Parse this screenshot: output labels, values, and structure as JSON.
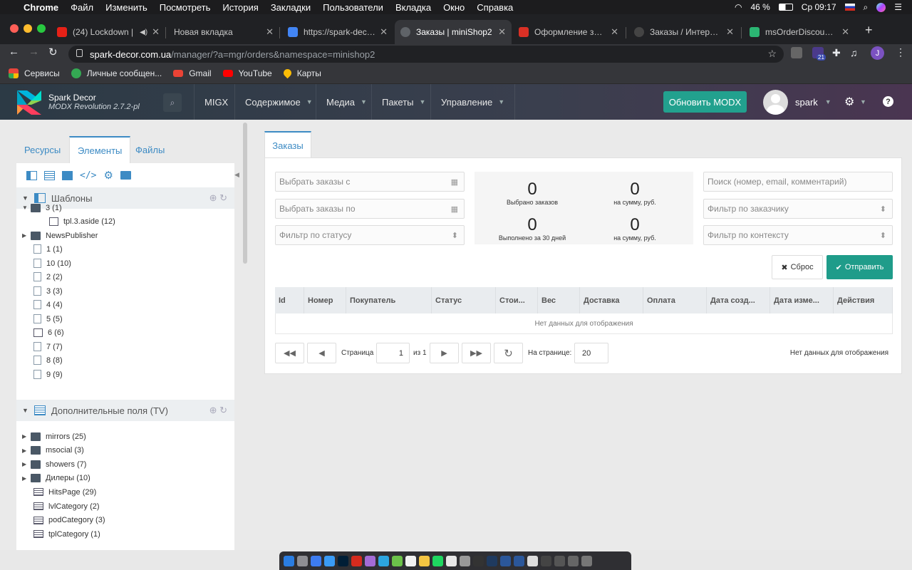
{
  "menubar": {
    "apple": "",
    "app": "Chrome",
    "items": [
      "Файл",
      "Изменить",
      "Посмотреть",
      "История",
      "Закладки",
      "Пользователи",
      "Вкладка",
      "Окно",
      "Справка"
    ],
    "battery": "46 %",
    "clock": "Ср 09:17"
  },
  "tabs": [
    {
      "title": "(24) Lockdown |",
      "color": "#e62117"
    },
    {
      "title": "Новая вкладка",
      "color": ""
    },
    {
      "title": "https://spark-decor.c",
      "color": "#4285f4"
    },
    {
      "title": "Заказы | miniShop2",
      "color": "#5f6368"
    },
    {
      "title": "Оформление заказа",
      "color": "#d93025"
    },
    {
      "title": "Заказы / Интерфейс",
      "color": "#444"
    },
    {
      "title": "msOrderDiscount / K",
      "color": "#2bb673"
    }
  ],
  "address": {
    "host": "spark-decor.com.ua",
    "path": "/manager/?a=mgr/orders&namespace=minishop2",
    "ext_badge": "21",
    "profile": "J"
  },
  "bookmarks": [
    {
      "label": "Сервисы",
      "color": "#e8453c"
    },
    {
      "label": "Личные сообщен...",
      "color": "#34a853"
    },
    {
      "label": "Gmail",
      "color": "#ea4335"
    },
    {
      "label": "YouTube",
      "color": "#ff0000"
    },
    {
      "label": "Карты",
      "color": "#fbbc05"
    }
  ],
  "modx": {
    "site": "Spark Decor",
    "version": "MODX Revolution 2.7.2-pl",
    "nav": [
      "MIGX",
      "Содержимое",
      "Медиа",
      "Пакеты",
      "Управление"
    ],
    "update": "Обновить MODX",
    "user": "spark"
  },
  "left": {
    "tabs": [
      "Ресурсы",
      "Элементы",
      "Файлы"
    ],
    "templates": {
      "title": "Шаблоны",
      "items": [
        {
          "label": "3 (1)",
          "kind": "folder",
          "level": 0,
          "expand": true
        },
        {
          "label": "tpl.3.aside (12)",
          "kind": "tpl",
          "level": 1
        },
        {
          "label": "NewsPublisher",
          "kind": "folder",
          "level": 0,
          "expand": true
        },
        {
          "label": "1 (1)",
          "kind": "doc",
          "level": 0
        },
        {
          "label": "10 (10)",
          "kind": "doc",
          "level": 0
        },
        {
          "label": "2 (2)",
          "kind": "doc",
          "level": 0
        },
        {
          "label": "3 (3)",
          "kind": "doc",
          "level": 0
        },
        {
          "label": "4 (4)",
          "kind": "doc",
          "level": 0
        },
        {
          "label": "5 (5)",
          "kind": "doc",
          "level": 0
        },
        {
          "label": "6 (6)",
          "kind": "tpl",
          "level": 0
        },
        {
          "label": "7 (7)",
          "kind": "doc",
          "level": 0
        },
        {
          "label": "8 (8)",
          "kind": "doc",
          "level": 0
        },
        {
          "label": "9 (9)",
          "kind": "doc",
          "level": 0
        }
      ]
    },
    "tvs": {
      "title": "Дополнительные поля (TV)",
      "items": [
        {
          "label": "mirrors (25)",
          "kind": "folder",
          "expand": true
        },
        {
          "label": "msocial (3)",
          "kind": "folder",
          "expand": true
        },
        {
          "label": "showers (7)",
          "kind": "folder",
          "expand": true
        },
        {
          "label": "Дилеры (10)",
          "kind": "folder",
          "expand": true
        },
        {
          "label": "HitsPage (29)",
          "kind": "tv"
        },
        {
          "label": "lvlCategory (2)",
          "kind": "tv"
        },
        {
          "label": "podCategory (3)",
          "kind": "tv"
        },
        {
          "label": "tplCategory (1)",
          "kind": "tv"
        }
      ]
    }
  },
  "main": {
    "tab": "Заказы",
    "filters": {
      "date_from": "Выбрать заказы с",
      "date_to": "Выбрать заказы по",
      "status": "Фильтр по статусу",
      "search": "Поиск (номер, email, комментарий)",
      "customer": "Фильтр по заказчику",
      "context": "Фильтр по контексту"
    },
    "stats": {
      "selected": {
        "value": "0",
        "label": "Выбрано заказов"
      },
      "sum1": {
        "value": "0",
        "label": "на сумму, руб."
      },
      "done": {
        "value": "0",
        "label": "Выполнено за 30 дней"
      },
      "sum2": {
        "value": "0",
        "label": "на сумму, руб."
      }
    },
    "reset": "Сброс",
    "submit": "Отправить",
    "columns": [
      "Id",
      "Номер",
      "Покупатель",
      "Статус",
      "Стои...",
      "Вес",
      "Доставка",
      "Оплата",
      "Дата созд...",
      "Дата изме...",
      "Действия"
    ],
    "empty": "Нет данных для отображения",
    "pager": {
      "page_label": "Страница",
      "page": "1",
      "of": "из 1",
      "per_page_label": "На странице:",
      "per_page": "20",
      "info": "Нет данных для отображения"
    }
  },
  "colors": {
    "accent": "#3d8bc4",
    "update_button": "#22a18e",
    "submit_button": "#1f9c8a"
  }
}
